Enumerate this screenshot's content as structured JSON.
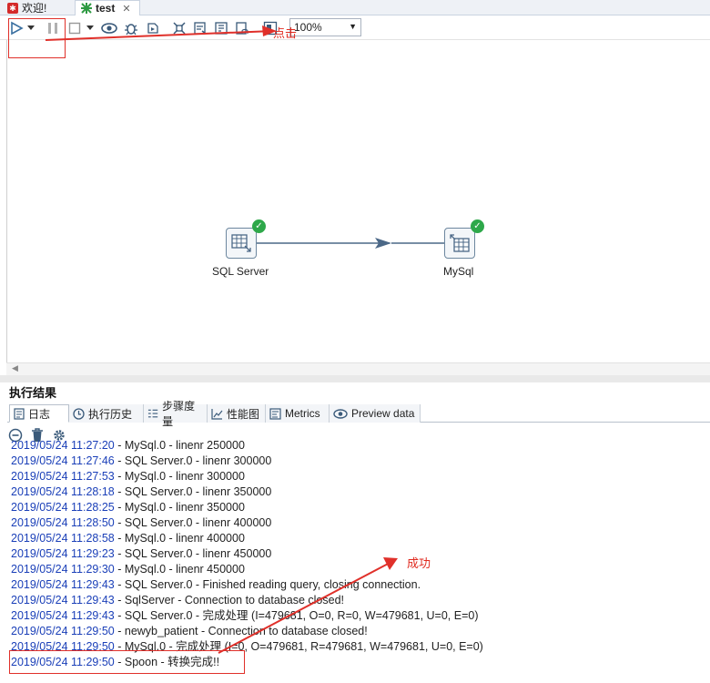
{
  "tabs": {
    "welcome": "欢迎!",
    "active": "test"
  },
  "toolbar": {
    "zoom_value": "100%",
    "icons": [
      "run-icon",
      "run-options-chevron-icon",
      "pause-icon",
      "stop-icon",
      "stop-options-chevron-icon",
      "preview-icon",
      "debug-icon",
      "replay-icon",
      "verify-icon",
      "impact-icon",
      "sql-icon",
      "explore-db-icon",
      "show-results-icon"
    ]
  },
  "canvas": {
    "steps": [
      {
        "label": "SQL Server",
        "status": "success"
      },
      {
        "label": "MySql",
        "status": "success"
      }
    ]
  },
  "results": {
    "title": "执行结果",
    "tabs": [
      "日志",
      "执行历史",
      "步骤度量",
      "性能图",
      "Metrics",
      "Preview data"
    ],
    "log_lines": [
      {
        "ts": "2019/05/24 11:27:20",
        "msg": " - MySql.0 - linenr 250000"
      },
      {
        "ts": "2019/05/24 11:27:46",
        "msg": " - SQL Server.0 - linenr 300000"
      },
      {
        "ts": "2019/05/24 11:27:53",
        "msg": " - MySql.0 - linenr 300000"
      },
      {
        "ts": "2019/05/24 11:28:18",
        "msg": " - SQL Server.0 - linenr 350000"
      },
      {
        "ts": "2019/05/24 11:28:25",
        "msg": " - MySql.0 - linenr 350000"
      },
      {
        "ts": "2019/05/24 11:28:50",
        "msg": " - SQL Server.0 - linenr 400000"
      },
      {
        "ts": "2019/05/24 11:28:58",
        "msg": " - MySql.0 - linenr 400000"
      },
      {
        "ts": "2019/05/24 11:29:23",
        "msg": " - SQL Server.0 - linenr 450000"
      },
      {
        "ts": "2019/05/24 11:29:30",
        "msg": " - MySql.0 - linenr 450000"
      },
      {
        "ts": "2019/05/24 11:29:43",
        "msg": " - SQL Server.0 - Finished reading query, closing connection."
      },
      {
        "ts": "2019/05/24 11:29:43",
        "msg": " - SqlServer - Connection to database closed!"
      },
      {
        "ts": "2019/05/24 11:29:43",
        "msg": " - SQL Server.0 - 完成处理 (I=479681, O=0, R=0, W=479681, U=0, E=0)"
      },
      {
        "ts": "2019/05/24 11:29:50",
        "msg": " - newyb_patient - Connection to database closed!"
      },
      {
        "ts": "2019/05/24 11:29:50",
        "msg": " - MySql.0 - 完成处理 (I=0, O=479681, R=479681, W=479681, U=0, E=0)"
      },
      {
        "ts": "2019/05/24 11:29:50",
        "msg": " - Spoon - 转换完成!!"
      }
    ]
  },
  "annotations": {
    "click_label": "点击",
    "success_label": "成功",
    "color": "#e0302a"
  }
}
